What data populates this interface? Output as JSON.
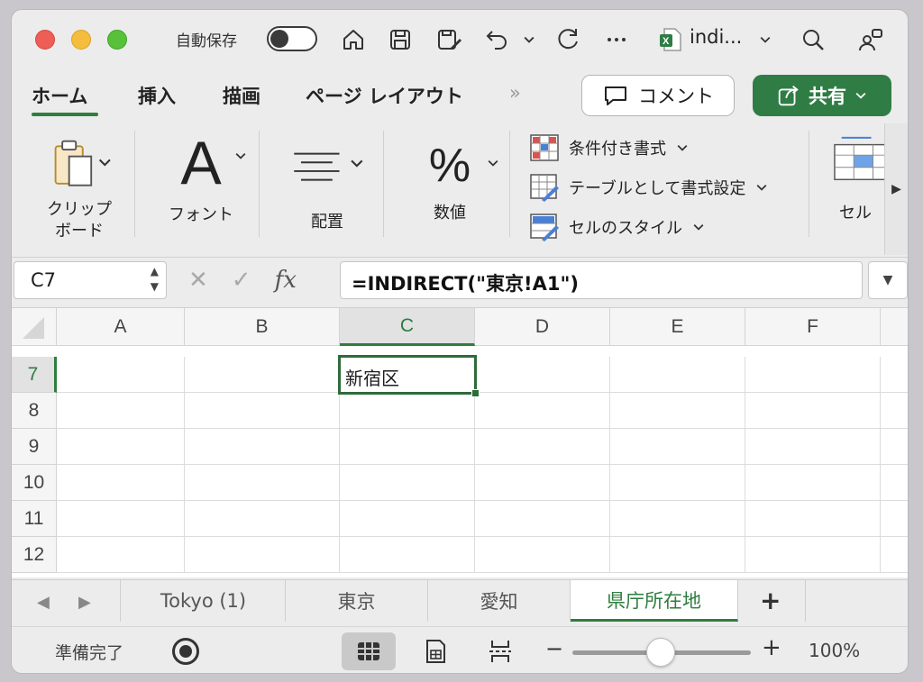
{
  "titlebar": {
    "autosave_label": "自動保存",
    "doc_name": "indi...",
    "icons": [
      "home-icon",
      "save-icon",
      "save-as-icon",
      "undo-icon",
      "redo-icon",
      "more-icon",
      "excel-file-icon",
      "search-icon",
      "share-people-icon"
    ]
  },
  "tabs": {
    "items": [
      "ホーム",
      "挿入",
      "描画",
      "ページ レイアウト"
    ],
    "active": "ホーム",
    "overflow": "»",
    "comment_label": "コメント",
    "share_label": "共有"
  },
  "ribbon": {
    "clipboard_label_line1": "クリップ",
    "clipboard_label_line2": "ボード",
    "font_glyph": "A",
    "font_label": "フォント",
    "align_label": "配置",
    "number_glyph": "%",
    "number_label": "数値",
    "conditional_format": "条件付き書式",
    "format_as_table": "テーブルとして書式設定",
    "cell_styles": "セルのスタイル",
    "cells_label": "セル"
  },
  "formula_bar": {
    "name_box": "C7",
    "fx": "fx",
    "formula": "=INDIRECT(\"東京!A1\")"
  },
  "grid": {
    "columns": [
      "A",
      "B",
      "C",
      "D",
      "E",
      "F"
    ],
    "selected_column": "C",
    "rows": [
      "7",
      "8",
      "9",
      "10",
      "11",
      "12"
    ],
    "selected_row": "7",
    "cells": {
      "C7": "新宿区"
    }
  },
  "sheets": {
    "tabs": [
      "Tokyo (1)",
      "東京",
      "愛知",
      "県庁所在地"
    ],
    "active": "県庁所在地",
    "add_label": "+"
  },
  "status": {
    "ready": "準備完了",
    "zoom": "100%",
    "zoom_level_percent": 100,
    "view_mode": "normal"
  },
  "colors": {
    "accent_green": "#2e7d3e",
    "share_green": "#2f7d45"
  }
}
